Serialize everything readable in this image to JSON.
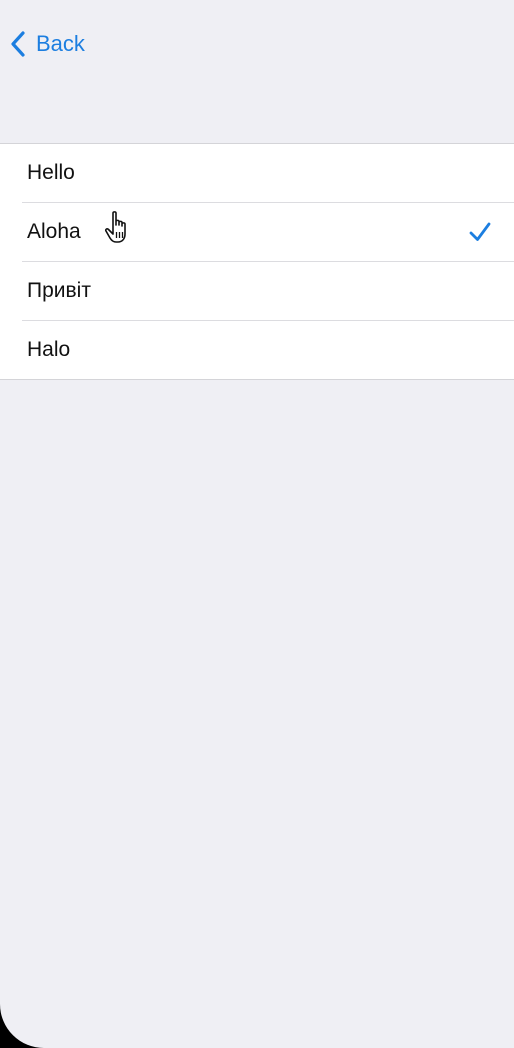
{
  "nav": {
    "back_label": "Back"
  },
  "colors": {
    "accent": "#1c7ee0",
    "background": "#efeff4",
    "cell": "#ffffff"
  },
  "options": [
    {
      "label": "Hello",
      "selected": false
    },
    {
      "label": "Aloha",
      "selected": true
    },
    {
      "label": "Привіт",
      "selected": false
    },
    {
      "label": "Halo",
      "selected": false
    }
  ],
  "icons": {
    "back": "chevron-left-icon",
    "selected": "checkmark-icon",
    "pointer": "hand-pointer-icon"
  }
}
